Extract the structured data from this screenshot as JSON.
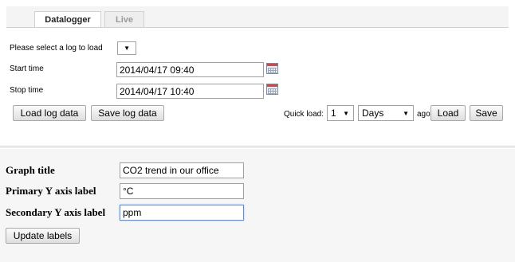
{
  "tabs": [
    {
      "label": "Datalogger"
    },
    {
      "label": "Live"
    }
  ],
  "datalogger": {
    "select_log_label": "Please select a log to load",
    "start_time_label": "Start time",
    "start_time_value": "2014/04/17 09:40",
    "stop_time_label": "Stop time",
    "stop_time_value": "2014/04/17 10:40",
    "load_button": "Load log data",
    "save_button": "Save log data",
    "quick_load_label": "Quick load:",
    "quick_load_count": "1",
    "quick_load_unit": "Days",
    "ago_label": "ago",
    "load_quick_button": "Load",
    "save_quick_button": "Save"
  },
  "graph": {
    "title_label": "Graph title",
    "title_value": "CO2 trend in our office",
    "primary_label": "Primary Y axis label",
    "primary_value": "°C",
    "secondary_label": "Secondary Y axis label",
    "secondary_value": "ppm",
    "update_button": "Update labels"
  },
  "icons": {
    "dropdown_arrow": "▼",
    "calendar": "calendar-icon"
  }
}
